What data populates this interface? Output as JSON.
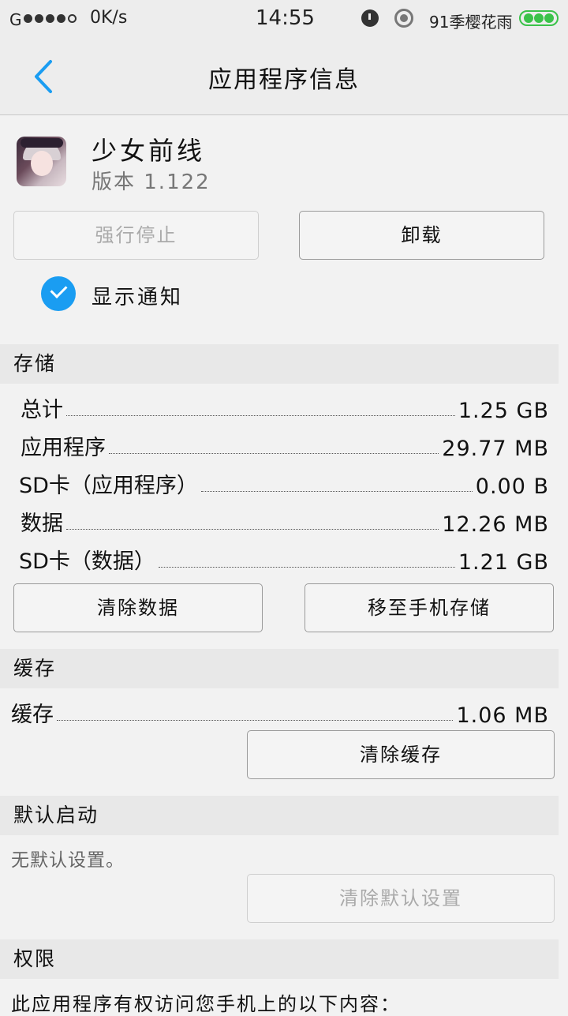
{
  "status": {
    "carrier": "G",
    "speed": "0K/s",
    "time": "14:55",
    "network_name": "91季樱花雨"
  },
  "header": {
    "title": "应用程序信息"
  },
  "app": {
    "name": "少女前线",
    "version": "版本 1.122"
  },
  "actions": {
    "force_stop": "强行停止",
    "uninstall": "卸载"
  },
  "notify": {
    "label": "显示通知",
    "checked": true
  },
  "storage": {
    "title": "存储",
    "rows": [
      {
        "label": "总计",
        "value": "1.25 GB"
      },
      {
        "label": "应用程序",
        "value": "29.77 MB"
      },
      {
        "label": "SD卡（应用程序）",
        "value": "0.00 B"
      },
      {
        "label": "数据",
        "value": "12.26 MB"
      },
      {
        "label": "SD卡（数据）",
        "value": "1.21 GB"
      }
    ],
    "clear_data": "清除数据",
    "move_to_phone": "移至手机存储"
  },
  "cache": {
    "title": "缓存",
    "label": "缓存",
    "value": "1.06 MB",
    "clear_cache": "清除缓存"
  },
  "defaults": {
    "title": "默认启动",
    "note": "无默认设置。",
    "clear_defaults": "清除默认设置"
  },
  "permissions": {
    "title": "权限",
    "text": "此应用程序有权访问您手机上的以下内容："
  },
  "colors": {
    "accent": "#1a9df2",
    "battery": "#3bc24a"
  }
}
